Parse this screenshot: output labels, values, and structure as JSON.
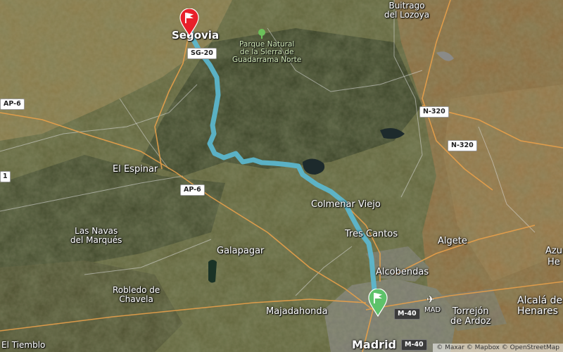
{
  "places": {
    "buitrago": "Buitrago\ndel Lozoya",
    "segovia": "Segovia",
    "park": "Parque Natural\nde la Sierra de\nGuadarrama Norte",
    "el_espinar": "El Espinar",
    "colmenar_viejo": "Colmenar Viejo",
    "tres_cantos": "Tres Cantos",
    "las_navas": "Las Navas\ndel Marqués",
    "galapagar": "Galapagar",
    "algete": "Algete",
    "alcobendas": "Alcobendas",
    "robledo": "Robledo de\nChavela",
    "majadahonda": "Majadahonda",
    "madrid": "Madrid",
    "torrejon": "Torrejón\nde Ardoz",
    "alcala": "Alcalá de\nHenares",
    "el_tiemblo": "El Tiemblo",
    "azu": "Azu",
    "he": "He",
    "airport_code": "MAD"
  },
  "roads": {
    "sg20": "SG-20",
    "ap6_west": "AP-6",
    "ap6_mid": "AP-6",
    "n320_a": "N-320",
    "n320_b": "N-320",
    "m40_a": "M-40",
    "m40_b": "M-40",
    "edge_1": "1"
  },
  "route": {
    "start": "Segovia",
    "end": "Madrid",
    "color": "#5bb8d0",
    "start_marker_color": "#e8202a",
    "end_marker_color": "#5ec26a"
  },
  "icons": {
    "start": "flag-red",
    "end": "flag-green",
    "park": "tree",
    "airport": "airplane"
  },
  "attribution": "© Maxar © Mapbox © OpenStreetMap"
}
